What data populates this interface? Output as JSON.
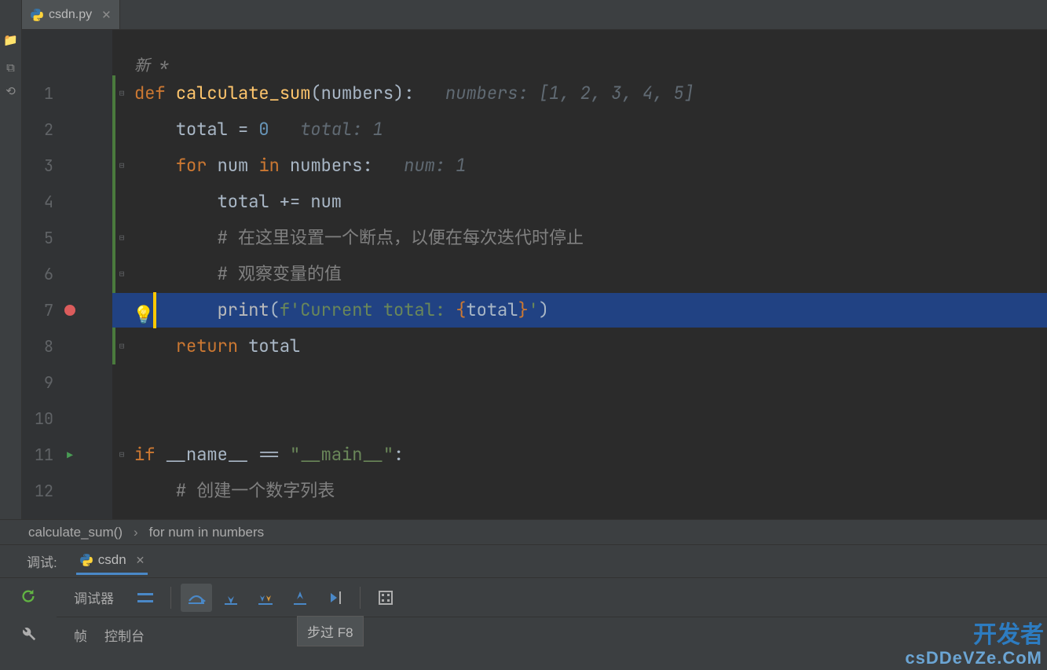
{
  "tab": {
    "name": "csdn.py"
  },
  "changed_label": "新 *",
  "gutter": [
    {
      "n": "1"
    },
    {
      "n": "2"
    },
    {
      "n": "3"
    },
    {
      "n": "4"
    },
    {
      "n": "5"
    },
    {
      "n": "6"
    },
    {
      "n": "7",
      "bp": true
    },
    {
      "n": "8"
    },
    {
      "n": "9"
    },
    {
      "n": "10"
    },
    {
      "n": "11",
      "run": true
    },
    {
      "n": "12"
    }
  ],
  "code": {
    "l1": {
      "def": "def ",
      "fn": "calculate_sum",
      "args": "(numbers):",
      "hint": "   numbers: [1, 2, 3, 4, 5]"
    },
    "l2": {
      "pre": "    ",
      "var": "total ",
      "op": "= ",
      "num": "0",
      "hint": "   total: 1"
    },
    "l3": {
      "pre": "    ",
      "for": "for ",
      "var": "num ",
      "in": "in ",
      "it": "numbers:",
      "hint": "   num: 1"
    },
    "l4": {
      "pre": "        ",
      "body": "total += num"
    },
    "l5": {
      "pre": "        ",
      "cm": "# 在这里设置一个断点，以便在每次迭代时停止"
    },
    "l6": {
      "pre": "        ",
      "cm": "# 观察变量的值"
    },
    "l7": {
      "pre": "        ",
      "fn": "print",
      "lp": "(",
      "fs": "f'",
      "str": "Current total: ",
      "lb": "{",
      "var": "total",
      "rb": "}",
      "fe": "'",
      ")": ")"
    },
    "l8": {
      "pre": "    ",
      "ret": "return ",
      "var": "total"
    },
    "l11": {
      "if": "if ",
      "name": "__name__ ",
      "eq": "== ",
      "str": "\"__main__\"",
      ":": ":"
    },
    "l12": {
      "pre": "    ",
      "cm": "# 创建一个数字列表"
    }
  },
  "breadcrumb": {
    "a": "calculate_sum()",
    "b": "for num in numbers"
  },
  "debug": {
    "label": "调试:",
    "tab": "csdn",
    "row1": "调试器",
    "sub1": "帧",
    "sub2": "控制台",
    "tooltip": "步过 F8"
  },
  "watermark_top": "开发者",
  "watermark": "csDDeVZe.CoM"
}
